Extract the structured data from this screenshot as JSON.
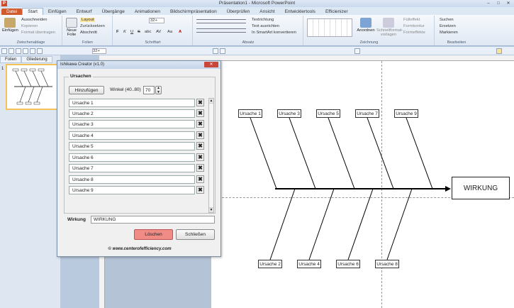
{
  "window": {
    "title": "Präsentation1 - Microsoft PowerPoint",
    "logo": "P",
    "min": "–",
    "max": "□",
    "close": "✕"
  },
  "tabs": [
    "Datei",
    "Start",
    "Einfügen",
    "Entwurf",
    "Übergänge",
    "Animationen",
    "Bildschirmpräsentation",
    "Überprüfen",
    "Ansicht",
    "Entwicklertools",
    "Efficienizer"
  ],
  "ribbon": {
    "clipboard": {
      "paste": "Einfügen",
      "cut": "Ausschneiden",
      "copy": "Kopieren",
      "format": "Format übertragen",
      "caption": "Zwischenablage"
    },
    "slides": {
      "new": "Neue Folie",
      "layout": "Layout",
      "reset": "Zurücksetzen",
      "section": "Abschnitt",
      "caption": "Folien"
    },
    "font": {
      "size": "32+",
      "caption": "Schriftart",
      "bold": "F",
      "italic": "K",
      "underline": "U",
      "strike": "S",
      "shadow": "abc",
      "spacing": "AV",
      "case": "Aa",
      "color": "A"
    },
    "paragraph": {
      "direction": "Textrichtung",
      "align": "Text ausrichten",
      "smartart": "In SmartArt konvertieren",
      "caption": "Absatz"
    },
    "drawing": {
      "arrange": "Anordnen",
      "quickstyles": "Schnellformat-vorlagen",
      "fill": "Fülleffekt",
      "outline": "Formkontur",
      "effects": "Formeffekte",
      "caption": "Zeichnung"
    },
    "editing": {
      "find": "Suchen",
      "replace": "Ersetzen",
      "select": "Markieren",
      "caption": "Bearbeiten"
    }
  },
  "qat": {
    "size": "32+"
  },
  "leftpane": {
    "tab1": "Folien",
    "tab2": "Gliederung",
    "slide_num": "1"
  },
  "dialog": {
    "title": "Ishikawa Creator (v1.0)",
    "close": "✕",
    "group": "Ursachen",
    "add": "Hinzufügen",
    "angle_label": "Winkel (40..80)",
    "angle_value": "70",
    "causes": [
      "Ursache 1",
      "Ursache 2",
      "Ursache 3",
      "Ursache 4",
      "Ursache 5",
      "Ursache 6",
      "Ursache 7",
      "Ursache 8",
      "Ursache 9"
    ],
    "remove": "✖",
    "scroll_up": "▲",
    "scroll_down": "▼",
    "effect_label": "Wirkung",
    "effect_value": "WIRKUNG",
    "delete": "Löschen",
    "close_btn": "Schließen",
    "footer": "© www.centerofefficiency.com"
  },
  "diagram": {
    "top": [
      "Ursache 1",
      "Ursache 3",
      "Ursache 5",
      "Ursache 7",
      "Ursache 9"
    ],
    "bottom": [
      "Ursache 2",
      "Ursache 4",
      "Ursache 6",
      "Ursache 8"
    ],
    "effect": "WIRKUNG"
  }
}
